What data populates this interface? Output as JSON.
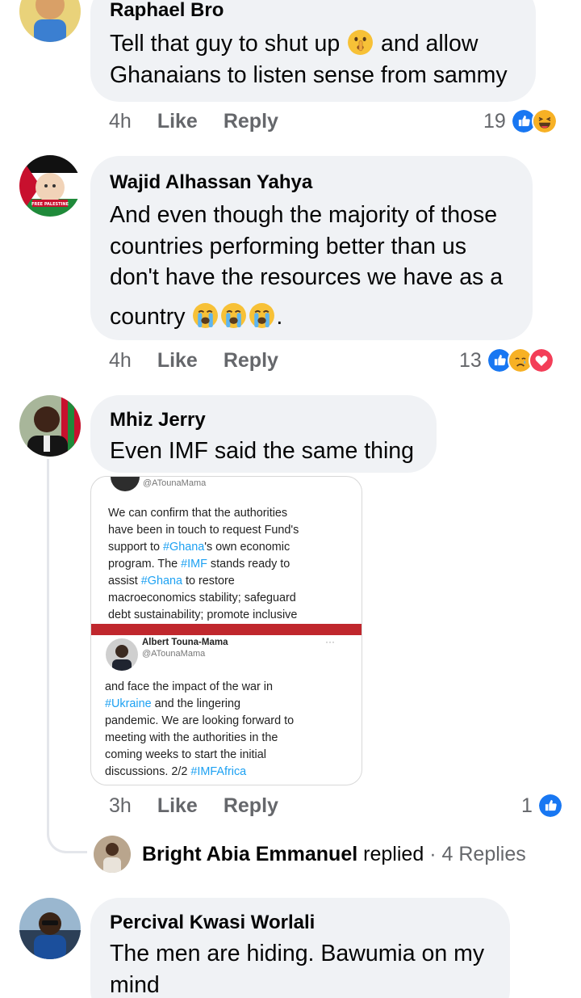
{
  "comments": [
    {
      "author": "Raphael Bro",
      "line1": "Tell that guy to shut up",
      "line1_after": "and allow",
      "line2": "Ghanaians to listen sense from sammy",
      "emoji": [
        "shushing-face"
      ],
      "time": "4h",
      "like": "Like",
      "reply": "Reply",
      "reaction_count": "19",
      "reactions": [
        "like",
        "haha"
      ]
    },
    {
      "author": "Wajid Alhassan Yahya",
      "lines": [
        "And even though the majority of those",
        "countries performing better than us",
        "don't have the resources we have as a"
      ],
      "last_line": "country",
      "last_line_end": ".",
      "emoji": [
        "loudly-crying-face",
        "loudly-crying-face",
        "loudly-crying-face"
      ],
      "avatar_badge": "FREE PALESTINE",
      "time": "4h",
      "like": "Like",
      "reply": "Reply",
      "reaction_count": "13",
      "reactions": [
        "like",
        "care",
        "love"
      ]
    },
    {
      "author": "Mhiz Jerry",
      "text": "Even IMF said the same thing",
      "time": "3h",
      "like": "Like",
      "reply": "Reply",
      "reaction_count": "1",
      "reactions": [
        "like"
      ],
      "attachment": {
        "top_handle": "@ATounaMama",
        "top_text": [
          [
            "We can confirm that the authorities"
          ],
          [
            "have been in touch to request Fund's"
          ],
          [
            "support to ",
            {
              "hl": "#Ghana"
            },
            "'s own economic"
          ],
          [
            "program. The ",
            {
              "hl": "#IMF"
            },
            " stands ready to"
          ],
          [
            "assist ",
            {
              "hl": "#Ghana"
            },
            " to restore"
          ],
          [
            "macroeconomics stability; safeguard"
          ],
          [
            "debt sustainability; promote inclusive"
          ]
        ],
        "bottom_name": "Albert Touna-Mama",
        "bottom_handle": "@ATounaMama",
        "bottom_more": "···",
        "bottom_text": [
          [
            "and face the impact of the war in"
          ],
          [
            {
              "hl": "#Ukraine"
            },
            " and the lingering"
          ],
          [
            "pandemic. We are looking forward to"
          ],
          [
            "meeting with the authorities in the"
          ],
          [
            "coming weeks to start the initial"
          ],
          [
            "discussions. 2/2 ",
            {
              "hl": "#IMFAfrica"
            }
          ]
        ]
      },
      "replies": {
        "name": "Bright Abia Emmanuel",
        "verb": "replied",
        "count": "· 4 Replies"
      }
    },
    {
      "author": "Percival Kwasi Worlali",
      "lines": [
        "The men are hiding. Bawumia on my",
        "mind"
      ]
    }
  ],
  "colors": {
    "bubble": "#f0f2f5",
    "meta": "#65676b",
    "like_blue": "#1877f2",
    "love_red": "#f33e58",
    "haha_yellow": "#f7b125",
    "hashtag": "#1da1f2",
    "tweet_divider": "#c0272d"
  }
}
